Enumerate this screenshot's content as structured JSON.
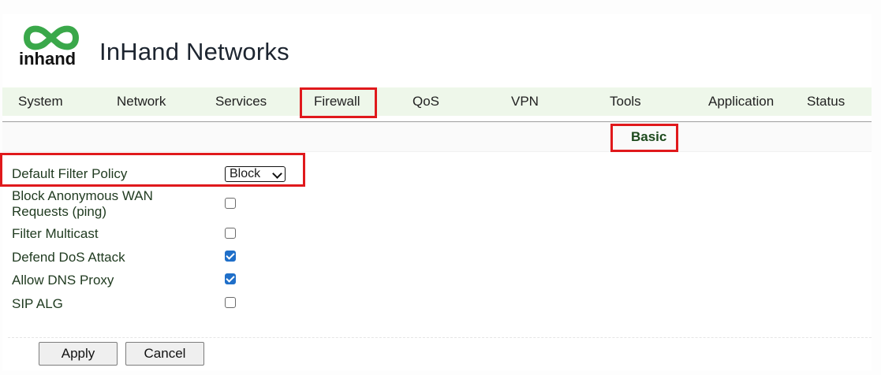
{
  "brand": {
    "logo_text": "inhand",
    "name": "InHand Networks"
  },
  "nav": [
    "System",
    "Network",
    "Services",
    "Firewall",
    "QoS",
    "VPN",
    "Tools",
    "Application",
    "Status"
  ],
  "active_nav": "Firewall",
  "subtabs": [
    "Basic"
  ],
  "form": {
    "default_filter_policy": {
      "label": "Default Filter Policy",
      "value": "Block"
    },
    "block_anonymous_wan": {
      "label_line1": "Block Anonymous WAN",
      "label_line2": "Requests (ping)",
      "checked": false
    },
    "filter_multicast": {
      "label": "Filter Multicast",
      "checked": false
    },
    "defend_dos": {
      "label": "Defend DoS Attack",
      "checked": true
    },
    "allow_dns_proxy": {
      "label": "Allow DNS Proxy",
      "checked": true
    },
    "sip_alg": {
      "label": "SIP ALG",
      "checked": false
    }
  },
  "buttons": {
    "apply": "Apply",
    "cancel": "Cancel"
  },
  "colors": {
    "highlight": "#e0191c",
    "nav_bg": "#eef7ea",
    "logo_green": "#3aa84a",
    "checkbox_blue": "#1f6fc9"
  }
}
